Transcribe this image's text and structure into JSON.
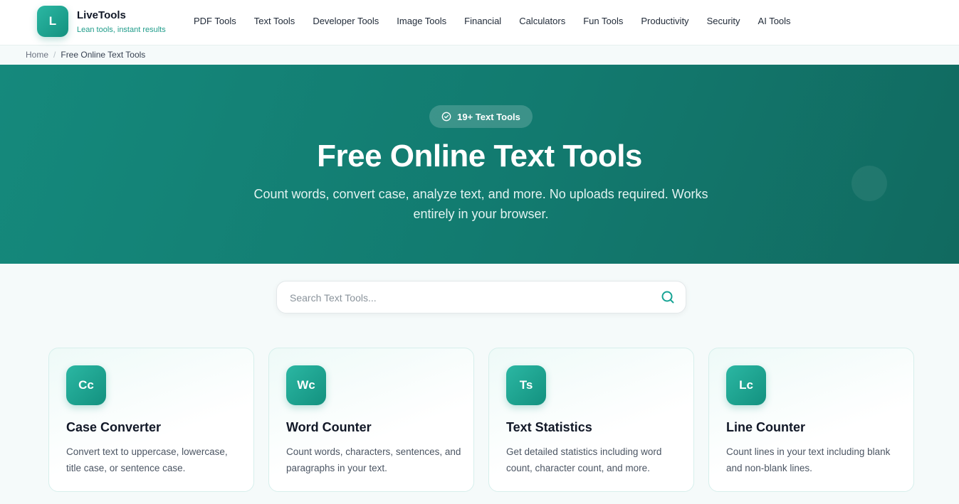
{
  "brand": {
    "logo_letter": "L",
    "name": "LiveTools",
    "tagline": "Lean tools, instant results"
  },
  "nav": [
    "PDF Tools",
    "Text Tools",
    "Developer Tools",
    "Image Tools",
    "Financial",
    "Calculators",
    "Fun Tools",
    "Productivity",
    "Security",
    "AI Tools"
  ],
  "breadcrumb": {
    "home": "Home",
    "separator": "/",
    "current": "Free Online Text Tools"
  },
  "hero": {
    "badge": "19+ Text Tools",
    "badge_icon": "check-circle-icon",
    "title": "Free Online Text Tools",
    "subtitle": "Count words, convert case, analyze text, and more. No uploads required. Works entirely in your browser."
  },
  "search": {
    "placeholder": "Search Text Tools...",
    "value": "",
    "icon": "search-icon"
  },
  "cards": [
    {
      "icon_text": "Cc",
      "title": "Case Converter",
      "description": "Convert text to uppercase, lowercase, title case, or sentence case."
    },
    {
      "icon_text": "Wc",
      "title": "Word Counter",
      "description": "Count words, characters, sentences, and paragraphs in your text."
    },
    {
      "icon_text": "Ts",
      "title": "Text Statistics",
      "description": "Get detailed statistics including word count, character count, and more."
    },
    {
      "icon_text": "Lc",
      "title": "Line Counter",
      "description": "Count lines in your text including blank and non-blank lines."
    }
  ],
  "colors": {
    "accent": "#16917f",
    "hero_start": "#15897c",
    "hero_end": "#116a60",
    "page_bg": "#f5fafa"
  }
}
